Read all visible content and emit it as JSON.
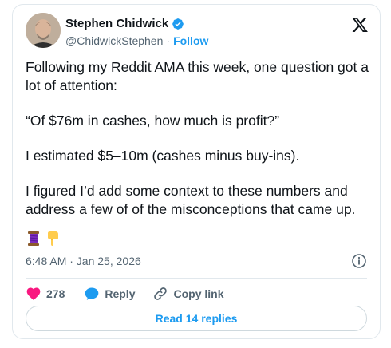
{
  "author": {
    "display_name": "Stephen Chidwick",
    "handle": "@ChidwickStephen",
    "separator": "·",
    "follow_label": "Follow",
    "verified_color": "#1d9bf0"
  },
  "tweet": {
    "paragraphs": [
      "Following my Reddit AMA this week, one question got a lot of attention:",
      "“Of $76m in cashes, how much is profit?”",
      "I estimated $5–10m (cashes minus buy-ins).",
      "I figured I’d add some context to these numbers and address a few of of the misconceptions that came up."
    ],
    "emojis": [
      "thread-spool-icon",
      "pointing-down-icon"
    ],
    "timestamp": "6:48 AM · Jan 25, 2026"
  },
  "actions": {
    "like_count": "278",
    "reply_label": "Reply",
    "copy_link_label": "Copy link"
  },
  "read_replies_label": "Read 14 replies",
  "colors": {
    "accent": "#1d9bf0",
    "like": "#f91880",
    "muted_text": "#536471",
    "border": "#e1e8ed"
  }
}
